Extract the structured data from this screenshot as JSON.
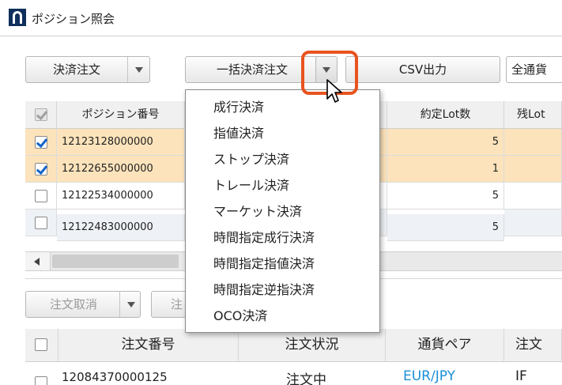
{
  "window": {
    "title": "ポジション照会"
  },
  "toolbar": {
    "settle_order": "決済注文",
    "bulk_settle": "一括決済注文",
    "csv_export": "CSV出力",
    "filter_value": "全通貨"
  },
  "positions_table": {
    "columns": [
      "ポジション番号",
      "約定Lot数",
      "残Lot"
    ],
    "rows": [
      {
        "id": "12123128000000",
        "lots": "5"
      },
      {
        "id": "12122655000000",
        "lots": "1"
      },
      {
        "id": "12122534000000",
        "lots": "5"
      },
      {
        "id": "12122483000000",
        "lots": "5"
      }
    ]
  },
  "orders_toolbar": {
    "cancel": "注文取消",
    "next": "注"
  },
  "orders_table": {
    "columns": [
      "注文番号",
      "注文状況",
      "通貨ペア",
      "注文"
    ],
    "rows": [
      {
        "id": "12084370000125",
        "status": "注文中",
        "pair": "EUR/JPY",
        "type": "IF"
      }
    ]
  },
  "dropdown": {
    "items": [
      "成行決済",
      "指値決済",
      "ストップ決済",
      "トレール決済",
      "マーケット決済",
      "時間指定成行決済",
      "時間指定指値決済",
      "時間指定逆指決済",
      "OCO決済"
    ]
  },
  "colors": {
    "accent_ring": "#e8541f",
    "selected_row": "#fce3bb",
    "link": "#1a8fd8",
    "logo": "#0f2f5c"
  }
}
